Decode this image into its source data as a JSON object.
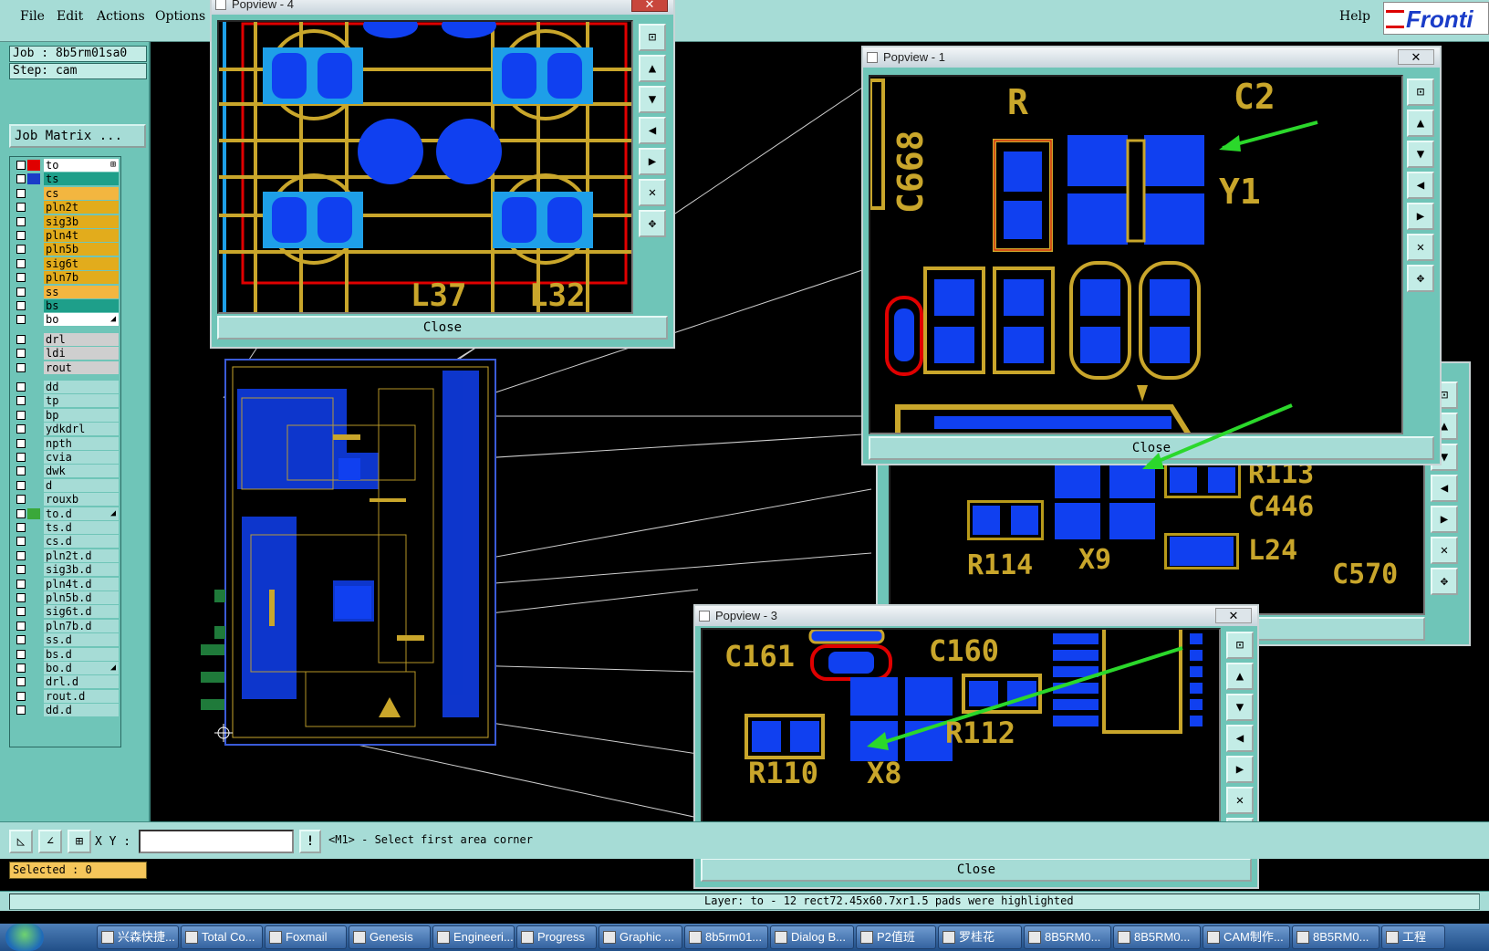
{
  "menu": {
    "file": "File",
    "edit": "Edit",
    "actions": "Actions",
    "options": "Options",
    "help": "Help"
  },
  "logo_text": "Fronti",
  "job": {
    "job_label": "Job : 8b5rm01sa0",
    "step_label": "Step: cam",
    "matrix_button": "Job Matrix ..."
  },
  "layers": [
    {
      "name": "to",
      "color": "#ffffff",
      "swatch": "#e00000",
      "mark": "⊞"
    },
    {
      "name": "ts",
      "color": "#1e9f8a",
      "swatch": "#1a3cc8",
      "mark": ""
    },
    {
      "name": "cs",
      "color": "#f3b640",
      "swatch": "",
      "mark": ""
    },
    {
      "name": "pln2t",
      "color": "#e2ac1c",
      "swatch": "",
      "mark": ""
    },
    {
      "name": "sig3b",
      "color": "#e2ac1c",
      "swatch": "",
      "mark": ""
    },
    {
      "name": "pln4t",
      "color": "#e2ac1c",
      "swatch": "",
      "mark": ""
    },
    {
      "name": "pln5b",
      "color": "#e2ac1c",
      "swatch": "",
      "mark": ""
    },
    {
      "name": "sig6t",
      "color": "#e2ac1c",
      "swatch": "",
      "mark": ""
    },
    {
      "name": "pln7b",
      "color": "#e2ac1c",
      "swatch": "",
      "mark": ""
    },
    {
      "name": "ss",
      "color": "#f3b640",
      "swatch": "",
      "mark": ""
    },
    {
      "name": "bs",
      "color": "#1e9f8a",
      "swatch": "",
      "mark": ""
    },
    {
      "name": "bo",
      "color": "#ffffff",
      "swatch": "",
      "mark": "◢"
    },
    {
      "name": "drl",
      "color": "#cfcfcf",
      "swatch": "",
      "mark": ""
    },
    {
      "name": "ldi",
      "color": "#cfcfcf",
      "swatch": "",
      "mark": ""
    },
    {
      "name": "rout",
      "color": "#cfcfcf",
      "swatch": "",
      "mark": ""
    },
    {
      "name": "dd",
      "color": "#a6dcd6",
      "swatch": "",
      "mark": ""
    },
    {
      "name": "tp",
      "color": "#a6dcd6",
      "swatch": "",
      "mark": ""
    },
    {
      "name": "bp",
      "color": "#a6dcd6",
      "swatch": "",
      "mark": ""
    },
    {
      "name": "ydkdrl",
      "color": "#a6dcd6",
      "swatch": "",
      "mark": ""
    },
    {
      "name": "npth",
      "color": "#a6dcd6",
      "swatch": "",
      "mark": ""
    },
    {
      "name": "cvia",
      "color": "#a6dcd6",
      "swatch": "",
      "mark": ""
    },
    {
      "name": "dwk",
      "color": "#a6dcd6",
      "swatch": "",
      "mark": ""
    },
    {
      "name": "d",
      "color": "#a6dcd6",
      "swatch": "",
      "mark": ""
    },
    {
      "name": "rouxb",
      "color": "#a6dcd6",
      "swatch": "",
      "mark": ""
    },
    {
      "name": "to.d",
      "color": "#a6dcd6",
      "swatch": "#3aa83a",
      "mark": "◢"
    },
    {
      "name": "ts.d",
      "color": "#a6dcd6",
      "swatch": "",
      "mark": ""
    },
    {
      "name": "cs.d",
      "color": "#a6dcd6",
      "swatch": "",
      "mark": ""
    },
    {
      "name": "pln2t.d",
      "color": "#a6dcd6",
      "swatch": "",
      "mark": ""
    },
    {
      "name": "sig3b.d",
      "color": "#a6dcd6",
      "swatch": "",
      "mark": ""
    },
    {
      "name": "pln4t.d",
      "color": "#a6dcd6",
      "swatch": "",
      "mark": ""
    },
    {
      "name": "pln5b.d",
      "color": "#a6dcd6",
      "swatch": "",
      "mark": ""
    },
    {
      "name": "sig6t.d",
      "color": "#a6dcd6",
      "swatch": "",
      "mark": ""
    },
    {
      "name": "pln7b.d",
      "color": "#a6dcd6",
      "swatch": "",
      "mark": ""
    },
    {
      "name": "ss.d",
      "color": "#a6dcd6",
      "swatch": "",
      "mark": ""
    },
    {
      "name": "bs.d",
      "color": "#a6dcd6",
      "swatch": "",
      "mark": ""
    },
    {
      "name": "bo.d",
      "color": "#a6dcd6",
      "swatch": "",
      "mark": "◢"
    },
    {
      "name": "drl.d",
      "color": "#a6dcd6",
      "swatch": "",
      "mark": ""
    },
    {
      "name": "rout.d",
      "color": "#a6dcd6",
      "swatch": "",
      "mark": ""
    },
    {
      "name": "dd.d",
      "color": "#a6dcd6",
      "swatch": "",
      "mark": ""
    }
  ],
  "selected": "Selected : 0",
  "xy_label": "X Y :",
  "xy_value": "",
  "prompt": "<M1> - Select first area corner",
  "status": "Layer: to - 12 rect72.45x60.7xr1.5 pads were highlighted",
  "popups": {
    "p4": {
      "title": "Popview - 4",
      "close": "Close"
    },
    "p1": {
      "title": "Popview - 1",
      "close": "Close"
    },
    "p2": {
      "title": "",
      "close": "Close"
    },
    "p3": {
      "title": "Popview - 3",
      "close": "Close"
    }
  },
  "pcb_labels": {
    "p4": [
      "L37",
      "L32"
    ],
    "p1": [
      "C668",
      "R",
      "C2",
      "Y1"
    ],
    "p2": [
      "R113",
      "C446",
      "R114",
      "X9",
      "L24",
      "C570"
    ],
    "p3": [
      "C161",
      "C160",
      "R112",
      "R110",
      "X8"
    ]
  },
  "taskbar": [
    "兴森快捷...",
    "Total Co...",
    "Foxmail",
    "Genesis",
    "Engineeri...",
    "Progress",
    "Graphic ...",
    "8b5rm01...",
    "Dialog B...",
    "P2值班",
    "罗桂花",
    "8B5RM0...",
    "8B5RM0...",
    "CAM制作...",
    "8B5RM0...",
    "工程"
  ],
  "colors": {
    "ui_teal": "#6fc5b8",
    "pad_blue": "#1040f0",
    "gold": "#b89a1a",
    "arrow_green": "#2bd82b"
  }
}
